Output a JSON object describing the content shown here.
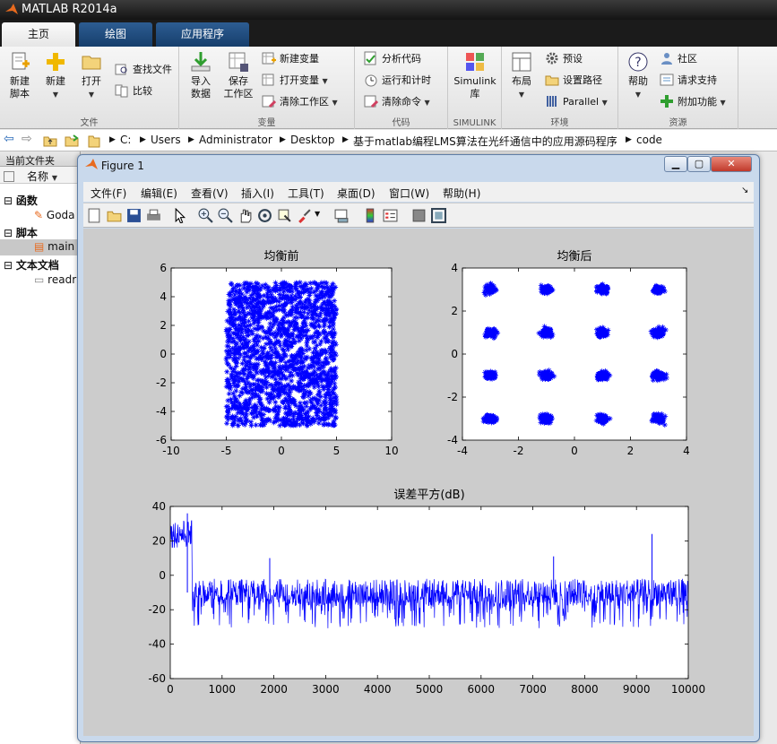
{
  "app": {
    "title": "MATLAB R2014a"
  },
  "tabs": [
    "主页",
    "绘图",
    "应用程序"
  ],
  "ribbon": {
    "file": {
      "caption": "文件",
      "new_script": "新建\n脚本",
      "new": "新建",
      "open": "打开",
      "find_files": "查找文件",
      "compare": "比较"
    },
    "variable": {
      "caption": "变量",
      "import": "导入\n数据",
      "save_ws": "保存\n工作区",
      "new_var": "新建变量",
      "open_var": "打开变量",
      "clear_ws": "清除工作区"
    },
    "code": {
      "caption": "代码",
      "analyze": "分析代码",
      "run_time": "运行和计时",
      "clear_cmd": "清除命令"
    },
    "simulink": {
      "caption": "SIMULINK",
      "lib": "Simulink\n库"
    },
    "env": {
      "caption": "环境",
      "layout": "布局",
      "prefs": "预设",
      "set_path": "设置路径",
      "parallel": "Parallel"
    },
    "resources": {
      "caption": "资源",
      "help": "帮助",
      "community": "社区",
      "support": "请求支持",
      "addons": "附加功能"
    }
  },
  "address": {
    "path": [
      "C:",
      "Users",
      "Administrator",
      "Desktop",
      "基于matlab编程LMS算法在光纤通信中的应用源码程序",
      "code"
    ]
  },
  "left_panel": {
    "header": "当前文件夹",
    "column": "名称",
    "groups": [
      {
        "label": "函数",
        "items": [
          "Goda"
        ]
      },
      {
        "label": "脚本",
        "items": [
          "main"
        ]
      },
      {
        "label": "文本文档",
        "items": [
          "readr"
        ]
      }
    ]
  },
  "figure": {
    "title": "Figure 1",
    "menu": [
      "文件(F)",
      "编辑(E)",
      "查看(V)",
      "插入(I)",
      "工具(T)",
      "桌面(D)",
      "窗口(W)",
      "帮助(H)"
    ],
    "colors": {
      "plot": "#0000ff",
      "panel": "#cccccc"
    }
  },
  "chart_data": [
    {
      "type": "scatter",
      "title": "均衡前",
      "xlabel": "",
      "ylabel": "",
      "xlim": [
        -10,
        10
      ],
      "ylim": [
        -6,
        6
      ],
      "xticks": [
        -10,
        -5,
        0,
        5,
        10
      ],
      "yticks": [
        -6,
        -4,
        -2,
        0,
        2,
        4,
        6
      ],
      "marker": "*",
      "x_range": [
        -5,
        5
      ],
      "y_range": [
        -5,
        5
      ],
      "description_points": "uniform square cloud of noisy points"
    },
    {
      "type": "scatter",
      "title": "均衡后",
      "xlabel": "",
      "ylabel": "",
      "xlim": [
        -4,
        4
      ],
      "ylim": [
        -4,
        4
      ],
      "xticks": [
        -4,
        -2,
        0,
        2,
        4
      ],
      "yticks": [
        -4,
        -2,
        0,
        2,
        4
      ],
      "marker": "*",
      "cluster_centers": [
        -3,
        -1,
        1,
        3
      ],
      "cluster_spread": 0.35
    },
    {
      "type": "line",
      "title": "误差平方(dB)",
      "xlabel": "",
      "ylabel": "",
      "xlim": [
        0,
        10000
      ],
      "ylim": [
        -60,
        40
      ],
      "xticks": [
        0,
        1000,
        2000,
        3000,
        4000,
        5000,
        6000,
        7000,
        8000,
        9000,
        10000
      ],
      "yticks": [
        -60,
        -40,
        -20,
        0,
        20,
        40
      ],
      "segments": [
        {
          "x_start": 0,
          "x_end": 420,
          "level": 24,
          "spread": 8
        },
        {
          "x_start": 420,
          "x_end": 10000,
          "level": -10,
          "spread": 8
        }
      ],
      "spikes": [
        [
          330,
          36
        ],
        [
          800,
          -4
        ],
        [
          1920,
          10
        ],
        [
          7400,
          11
        ],
        [
          9300,
          24
        ]
      ]
    }
  ]
}
